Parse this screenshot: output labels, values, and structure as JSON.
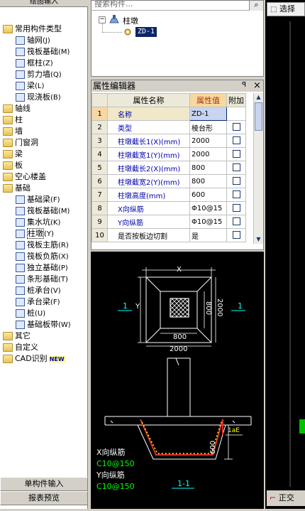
{
  "left_panel": {
    "header": "绘图输入",
    "tree": [
      {
        "label": "常用构件类型",
        "level": 0,
        "type": "folder-open"
      },
      {
        "label": "轴网",
        "key": "(J)",
        "level": 1
      },
      {
        "label": "筏板基础",
        "key": "(M)",
        "level": 1
      },
      {
        "label": "框柱",
        "key": "(Z)",
        "level": 1
      },
      {
        "label": "剪力墙",
        "key": "(Q)",
        "level": 1
      },
      {
        "label": "梁",
        "key": "(L)",
        "level": 1
      },
      {
        "label": "现浇板",
        "key": "(B)",
        "level": 1
      },
      {
        "label": "轴线",
        "level": 0,
        "type": "folder"
      },
      {
        "label": "柱",
        "level": 0,
        "type": "folder"
      },
      {
        "label": "墙",
        "level": 0,
        "type": "folder"
      },
      {
        "label": "门窗洞",
        "level": 0,
        "type": "folder"
      },
      {
        "label": "梁",
        "level": 0,
        "type": "folder"
      },
      {
        "label": "板",
        "level": 0,
        "type": "folder"
      },
      {
        "label": "空心楼盖",
        "level": 0,
        "type": "folder"
      },
      {
        "label": "基础",
        "level": 0,
        "type": "folder-open"
      },
      {
        "label": "基础梁",
        "key": "(F)",
        "level": 1
      },
      {
        "label": "筏板基础",
        "key": "(M)",
        "level": 1
      },
      {
        "label": "集水坑",
        "key": "(K)",
        "level": 1
      },
      {
        "label": "柱墩",
        "key": "(Y)",
        "level": 1,
        "selected": true
      },
      {
        "label": "筏板主筋",
        "key": "(R)",
        "level": 1
      },
      {
        "label": "筏板负筋",
        "key": "(X)",
        "level": 1
      },
      {
        "label": "独立基础",
        "key": "(P)",
        "level": 1
      },
      {
        "label": "条形基础",
        "key": "(T)",
        "level": 1
      },
      {
        "label": "桩承台",
        "key": "(V)",
        "level": 1
      },
      {
        "label": "承台梁",
        "key": "(F)",
        "level": 1
      },
      {
        "label": "桩",
        "key": "(U)",
        "level": 1
      },
      {
        "label": "基础板带",
        "key": "(W)",
        "level": 1
      },
      {
        "label": "其它",
        "level": 0,
        "type": "folder"
      },
      {
        "label": "自定义",
        "level": 0,
        "type": "folder"
      },
      {
        "label": "CAD识别",
        "level": 0,
        "type": "folder",
        "badge": "NEW"
      }
    ],
    "bottom_tabs": [
      "单构件输入",
      "报表预览"
    ]
  },
  "component_tree": {
    "search_placeholder": "搜索构件...",
    "root": "柱墩",
    "child": "ZD-1"
  },
  "property_editor": {
    "title": "属性编辑器",
    "pin": "ꟼ",
    "close": "×",
    "headers": [
      "属性名称",
      "属性值",
      "附加"
    ],
    "rows": [
      {
        "n": "1",
        "name": "名称",
        "value": "ZD-1",
        "check": false
      },
      {
        "n": "2",
        "name": "类型",
        "value": "棱台形",
        "check": true
      },
      {
        "n": "3",
        "name": "柱墩截长1(X)(mm)",
        "value": "2000",
        "check": true
      },
      {
        "n": "4",
        "name": "柱墩截宽1(Y)(mm)",
        "value": "2000",
        "check": true
      },
      {
        "n": "5",
        "name": "柱墩截长2(X)(mm)",
        "value": "800",
        "check": true
      },
      {
        "n": "6",
        "name": "柱墩截宽2(Y)(mm)",
        "value": "800",
        "check": true
      },
      {
        "n": "7",
        "name": "柱墩高度(mm)",
        "value": "600",
        "check": true
      },
      {
        "n": "8",
        "name": "X向纵筋",
        "value": "Φ10@15",
        "check": true
      },
      {
        "n": "9",
        "name": "Y向纵筋",
        "value": "Φ10@15",
        "check": true
      },
      {
        "n": "10",
        "name": "是否按板边切割",
        "value": "是",
        "check": true
      }
    ]
  },
  "drawing": {
    "x_label": "X",
    "y_label": "Y",
    "dim_800_v": "800",
    "dim_2000_v": "2000",
    "dim_800_h": "800",
    "dim_2000_h": "2000",
    "section_mark_left": "1",
    "section_mark_right": "1",
    "lae": "1aE",
    "h600": "600",
    "x_rebar_label": "X向纵筋",
    "x_rebar_value": "C10@150",
    "y_rebar_label": "Y向纵筋",
    "y_rebar_value": "C10@150",
    "section_title": "1-1"
  },
  "right_panel": {
    "select_button": "选择",
    "orth_label": "正交"
  }
}
